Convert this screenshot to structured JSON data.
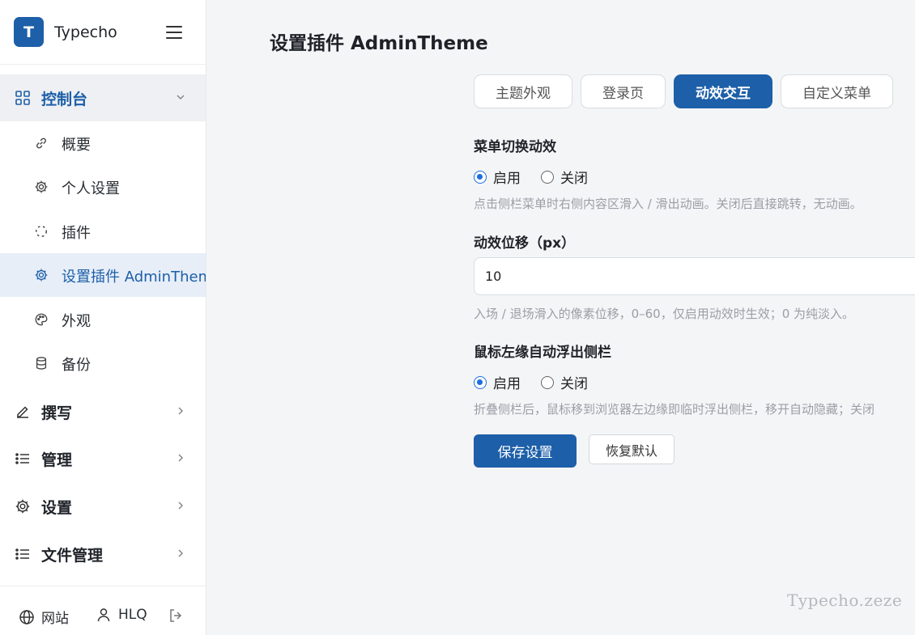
{
  "brand": {
    "logo_letter": "T",
    "name": "Typecho"
  },
  "sidebar": {
    "groups": [
      {
        "label": "控制台",
        "icon": "grid-icon",
        "expanded": true
      },
      {
        "label": "撰写",
        "icon": "pencil-icon"
      },
      {
        "label": "管理",
        "icon": "list-icon"
      },
      {
        "label": "设置",
        "icon": "gear-icon"
      },
      {
        "label": "文件管理",
        "icon": "list-icon"
      }
    ],
    "items": [
      {
        "label": "概要",
        "icon": "link-icon"
      },
      {
        "label": "个人设置",
        "icon": "gear-icon"
      },
      {
        "label": "插件",
        "icon": "dashed-circle-icon"
      },
      {
        "label": "设置插件 AdminTheme",
        "icon": "gear-icon",
        "active": true
      },
      {
        "label": "外观",
        "icon": "palette-icon"
      },
      {
        "label": "备份",
        "icon": "database-icon"
      }
    ],
    "footer": {
      "site_label": "网站",
      "user_label": "HLQ"
    }
  },
  "main": {
    "title": "设置插件 AdminTheme",
    "tabs": [
      {
        "label": "主题外观"
      },
      {
        "label": "登录页"
      },
      {
        "label": "动效交互",
        "active": true
      },
      {
        "label": "自定义菜单"
      }
    ],
    "sections": {
      "menu_anim": {
        "label": "菜单切换动效",
        "option_on": "启用",
        "option_off": "关闭",
        "selected": "启用",
        "hint": "点击侧栏菜单时右侧内容区滑入 / 滑出动画。关闭后直接跳转，无动画。"
      },
      "offset": {
        "label": "动效位移（px）",
        "value": "10",
        "hint": "入场 / 退场滑入的像素位移，0–60，仅启用动效时生效；0 为纯淡入。"
      },
      "edge_float": {
        "label": "鼠标左缘自动浮出侧栏",
        "option_on": "启用",
        "option_off": "关闭",
        "selected": "启用",
        "hint": "折叠侧栏后，鼠标移到浏览器左边缘即临时浮出侧栏，移开自动隐藏；关闭"
      }
    },
    "save_label": "保存设置",
    "reset_label": "恢复默认"
  },
  "watermark": "Typecho.zeze",
  "colors": {
    "primary": "#1d5fa8",
    "radio": "#1d6fe0"
  }
}
